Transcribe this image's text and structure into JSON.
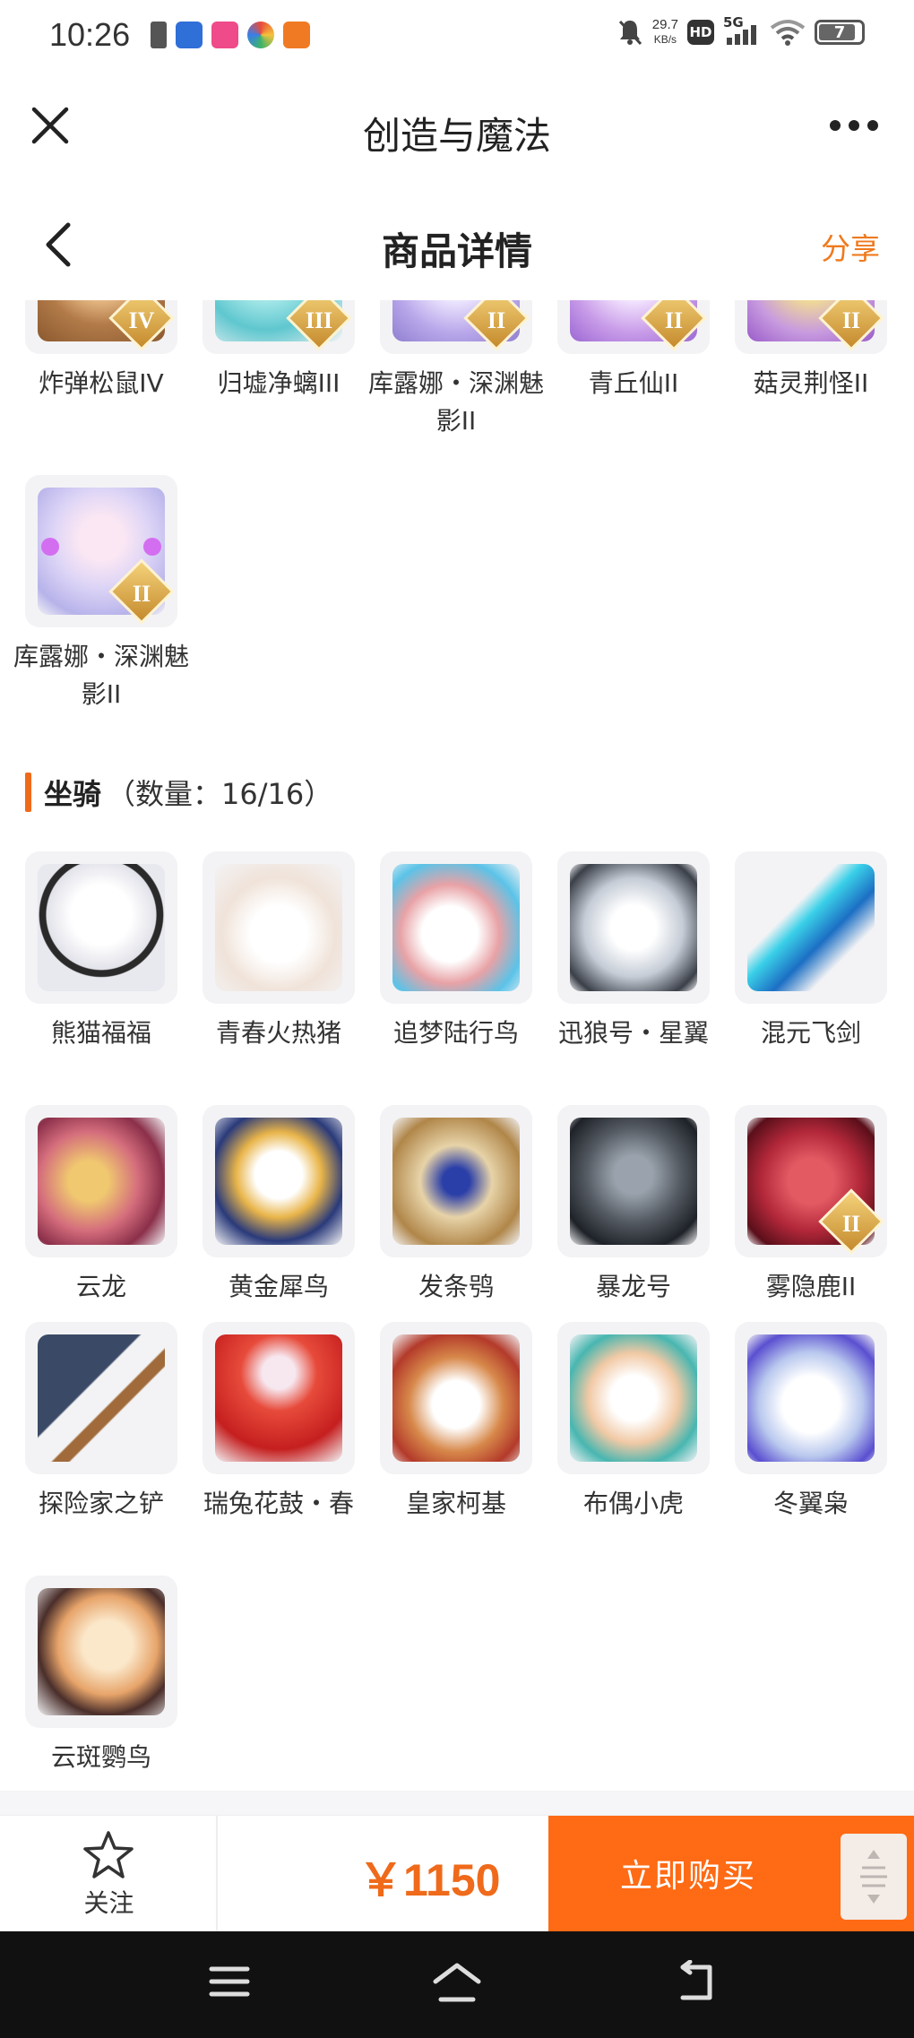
{
  "status_bar": {
    "time": "10:26",
    "net_speed_value": "29.7",
    "net_speed_unit": "KB/s",
    "hd": "HD",
    "signal": "5G",
    "battery": "7"
  },
  "top_bar": {
    "title": "创造与魔法",
    "close_icon": "close-icon",
    "more_icon": "more-icon"
  },
  "page_header": {
    "title": "商品详情",
    "share": "分享"
  },
  "pets_row_partial": [
    {
      "name": "炸弹松鼠IV",
      "badge": "IV",
      "color": "#c9895a"
    },
    {
      "name": "归墟净螭III",
      "badge": "III",
      "color": "#7fd6d9"
    },
    {
      "name": "库露娜・深渊魅影II",
      "badge": "II",
      "color": "#c8b7ef"
    },
    {
      "name": "青丘仙II",
      "badge": "II",
      "color": "#d8b9f0"
    },
    {
      "name": "菇灵荆怪II",
      "badge": "II",
      "color": "#d9c85a"
    }
  ],
  "pets_extra": [
    {
      "name": "库露娜・深渊魅影II",
      "badge": "II",
      "color": "#d9d2f2"
    }
  ],
  "mounts_section": {
    "title": "坐骑",
    "count": "（数量：16/16）"
  },
  "mounts": [
    {
      "name": "熊猫福福",
      "color": "#e8e8ef"
    },
    {
      "name": "青春火热猪",
      "color": "#f0e3d9"
    },
    {
      "name": "追梦陆行鸟",
      "color": "#e3b6b8"
    },
    {
      "name": "迅狼号・星翼",
      "color": "#c5ccd6"
    },
    {
      "name": "混元飞剑",
      "color": "#2f8fd0"
    },
    {
      "name": "云龙",
      "color": "#d46d7c"
    },
    {
      "name": "黄金犀鸟",
      "color": "#e9b54a"
    },
    {
      "name": "发条鸮",
      "color": "#c9a46a"
    },
    {
      "name": "暴龙号",
      "color": "#555b63"
    },
    {
      "name": "雾隐鹿II",
      "color": "#b3283a",
      "badge": "II"
    },
    {
      "name": "探险家之铲",
      "color": "#4a5a73"
    },
    {
      "name": "瑞兔花鼓・春",
      "color": "#d42a2a"
    },
    {
      "name": "皇家柯基",
      "color": "#d7884a"
    },
    {
      "name": "布偶小虎",
      "color": "#f1c9a5"
    },
    {
      "name": "冬翼枭",
      "color": "#b9c8ee"
    },
    {
      "name": "云斑鹦鸟",
      "color": "#e7a46a"
    }
  ],
  "bottom_bar": {
    "follow": "关注",
    "price": "￥1150",
    "buy": "立即购买"
  },
  "accent_color": "#ff6a14"
}
